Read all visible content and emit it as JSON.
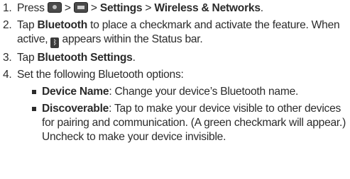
{
  "steps": [
    {
      "num": "1.",
      "t1": "Press",
      "sep1": ">",
      "sep2": ">",
      "b1": "Settings",
      "sep3": ">",
      "b2": "Wireless & Networks",
      "end": "."
    },
    {
      "num": "2.",
      "t1": "Tap",
      "b1": "Bluetooth",
      "t2": "to place a checkmark and activate the feature. When active,",
      "t3": "appears within the Status bar."
    },
    {
      "num": "3.",
      "t1": "Tap",
      "b1": "Bluetooth Settings",
      "end": "."
    },
    {
      "num": "4.",
      "t1": "Set the following Bluetooth options:",
      "bullets": [
        {
          "term": "Device Name",
          "text": ": Change your device’s Bluetooth name."
        },
        {
          "term": "Discoverable",
          "text": ": Tap to make your device visible to other devices for pairing and communication. (A green checkmark will appear.) Uncheck to make your device invisible."
        }
      ]
    }
  ],
  "icons": {
    "home": "home-key-icon",
    "menu": "menu-key-icon",
    "bluetooth": "bluetooth-status-icon"
  }
}
